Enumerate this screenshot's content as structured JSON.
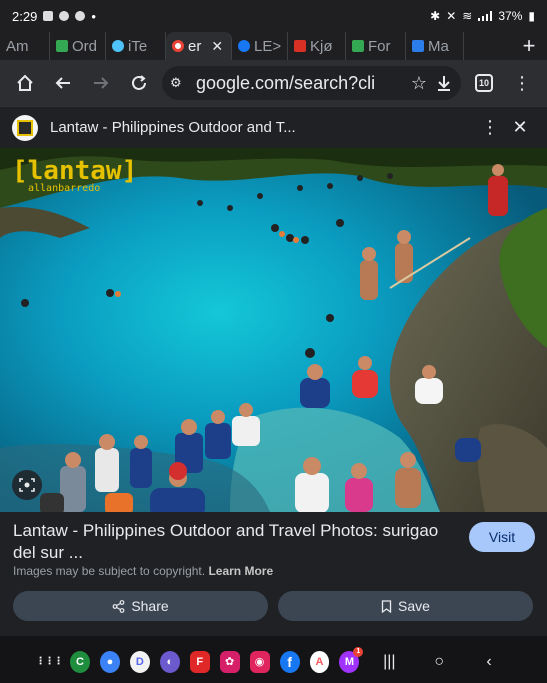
{
  "status_bar": {
    "time": "2:29",
    "battery": "37%"
  },
  "tabs": [
    {
      "label": "Am",
      "color": "#5f6368"
    },
    {
      "label": "Ord",
      "color": "#34a853"
    },
    {
      "label": "iTe",
      "color": "#4fc3f7"
    },
    {
      "label": "er",
      "color": "#ea4335",
      "active": true
    },
    {
      "label": "LE>",
      "color": "#1877f2"
    },
    {
      "label": "Kjø",
      "color": "#d93025"
    },
    {
      "label": "For",
      "color": "#34a853"
    },
    {
      "label": "Ma",
      "color": "#2b7de9"
    }
  ],
  "tab_close": "✕",
  "tab_add": "+",
  "toolbar": {
    "url": "google.com/search?cli",
    "tab_count": "10"
  },
  "result": {
    "site_name": "Lantaw - Philippines Outdoor and T...",
    "title": "Lantaw - Philippines Outdoor and Travel Photos: surigao del sur ...",
    "visit_label": "Visit",
    "copyright_text": "Images may be subject to copyright.",
    "learn_more": "Learn More",
    "share_label": "Share",
    "save_label": "Save"
  },
  "photo": {
    "watermark_logo": "[lantaw]",
    "watermark_sub": "allanbarredo"
  },
  "nav": {
    "apps": [
      {
        "name": "apps-grid",
        "glyph": "⋮⋮⋮",
        "color": "#141416"
      },
      {
        "name": "phone-app",
        "glyph": "C",
        "color": "#1e8e3e"
      },
      {
        "name": "messages-app",
        "glyph": "●",
        "color": "#3b82f6"
      },
      {
        "name": "discord-app",
        "glyph": "D",
        "color": "#5865f2"
      },
      {
        "name": "samsung-internet-app",
        "glyph": "◐",
        "color": "#6a5acd"
      },
      {
        "name": "flipboard-app",
        "glyph": "F",
        "color": "#e12828"
      },
      {
        "name": "flower-app",
        "glyph": "✿",
        "color": "#d61f69"
      },
      {
        "name": "camera-app",
        "glyph": "◉",
        "color": "#e0245e"
      },
      {
        "name": "facebook-app",
        "glyph": "f",
        "color": "#1877f2"
      },
      {
        "name": "airbnb-app",
        "glyph": "A",
        "color": "#ff5a5f"
      },
      {
        "name": "messenger-app",
        "glyph": "M",
        "color": "#a033ff"
      }
    ],
    "messenger_badge": "1"
  }
}
